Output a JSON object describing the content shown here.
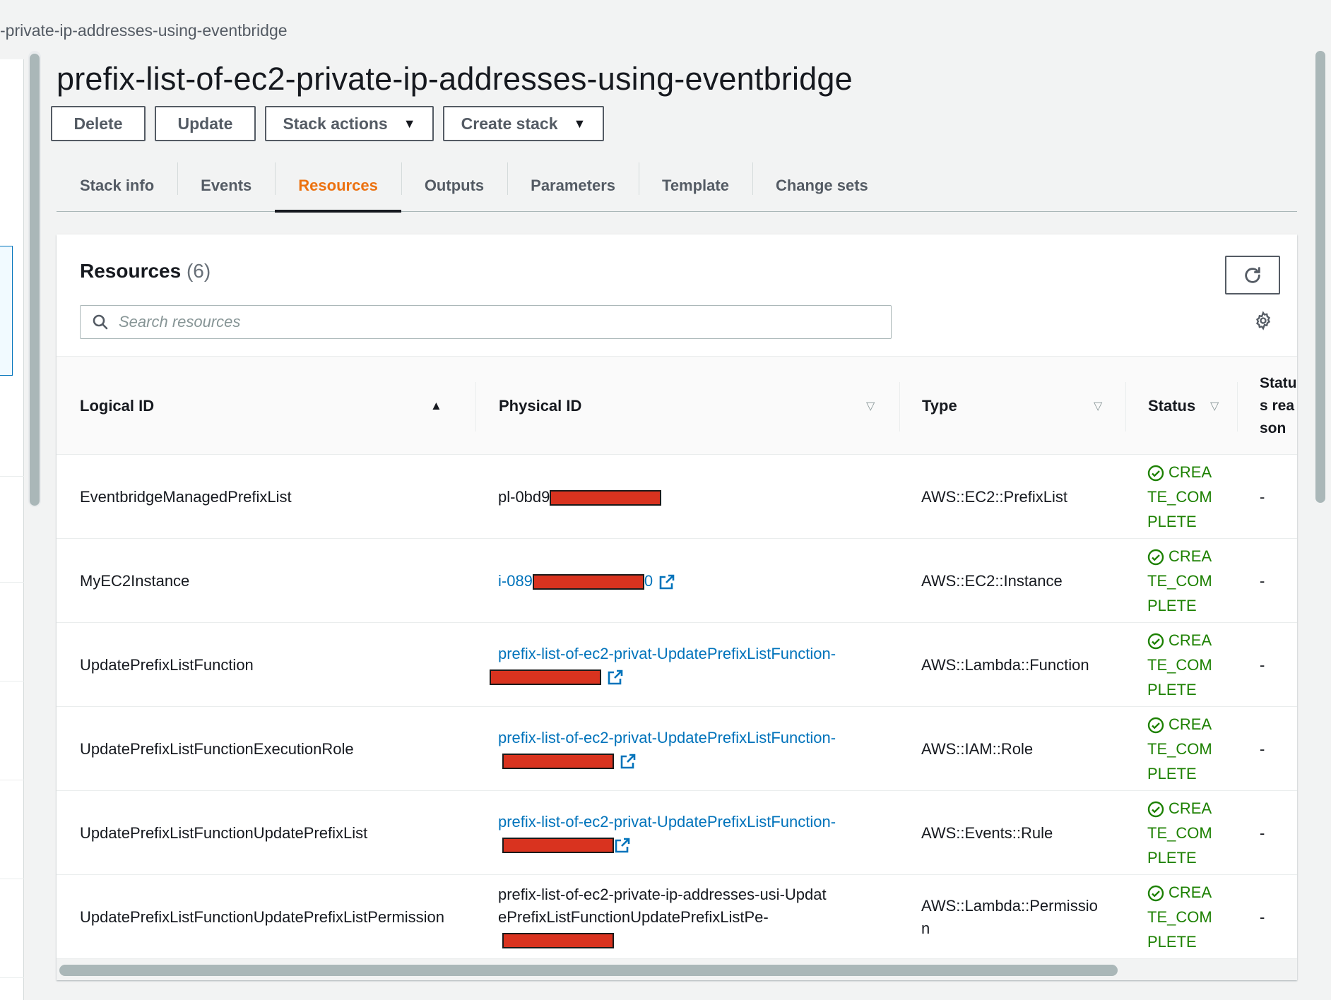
{
  "breadcrumb": "-private-ip-addresses-using-eventbridge",
  "title": "prefix-list-of-ec2-private-ip-addresses-using-eventbridge",
  "actions": {
    "delete": "Delete",
    "update": "Update",
    "stack_actions": "Stack actions",
    "create_stack": "Create stack"
  },
  "tabs": [
    "Stack info",
    "Events",
    "Resources",
    "Outputs",
    "Parameters",
    "Template",
    "Change sets"
  ],
  "active_tab": "Resources",
  "panel": {
    "title": "Resources",
    "count": "(6)",
    "search_placeholder": "Search resources"
  },
  "columns": {
    "logical_id": "Logical ID",
    "physical_id": "Physical ID",
    "type": "Type",
    "status": "Status",
    "status_reason": "Status reason"
  },
  "rows": [
    {
      "logical_id": "EventbridgeManagedPrefixList",
      "physical_prefix": "pl-0bd9",
      "physical_suffix": "",
      "physical_link": false,
      "type": "AWS::EC2::PrefixList",
      "status": "CREATE_COMPLETE",
      "status_reason": "-"
    },
    {
      "logical_id": "MyEC2Instance",
      "physical_prefix": "i-089",
      "physical_suffix": "0",
      "physical_link": true,
      "type": "AWS::EC2::Instance",
      "status": "CREATE_COMPLETE",
      "status_reason": "-"
    },
    {
      "logical_id": "UpdatePrefixListFunction",
      "physical_prefix": "prefix-list-of-ec2-privat-UpdatePrefixListFunction-",
      "physical_suffix": "",
      "physical_link": true,
      "type": "AWS::Lambda::Function",
      "status": "CREATE_COMPLETE",
      "status_reason": "-"
    },
    {
      "logical_id": "UpdatePrefixListFunctionExecutionRole",
      "physical_prefix": "prefix-list-of-ec2-privat-UpdatePrefixListFunction-",
      "physical_suffix": "",
      "physical_link": true,
      "type": "AWS::IAM::Role",
      "status": "CREATE_COMPLETE",
      "status_reason": "-"
    },
    {
      "logical_id": "UpdatePrefixListFunctionUpdatePrefixList",
      "physical_prefix": "prefix-list-of-ec2-privat-UpdatePrefixListFunction-",
      "physical_suffix": "",
      "physical_link": true,
      "type": "AWS::Events::Rule",
      "status": "CREATE_COMPLETE",
      "status_reason": "-"
    },
    {
      "logical_id": "UpdatePrefixListFunctionUpdatePrefixListPermission",
      "physical_prefix": "prefix-list-of-ec2-private-ip-addresses-usi-UpdatePrefixListFunctionUpdatePrefixListPe-",
      "physical_suffix": "",
      "physical_link": false,
      "type": "AWS::Lambda::Permission",
      "status": "CREATE_COMPLETE",
      "status_reason": "-"
    }
  ],
  "colors": {
    "accent_tab": "#ec7211",
    "link": "#0073bb",
    "success": "#1d8102",
    "redaction": "#d9331f"
  }
}
